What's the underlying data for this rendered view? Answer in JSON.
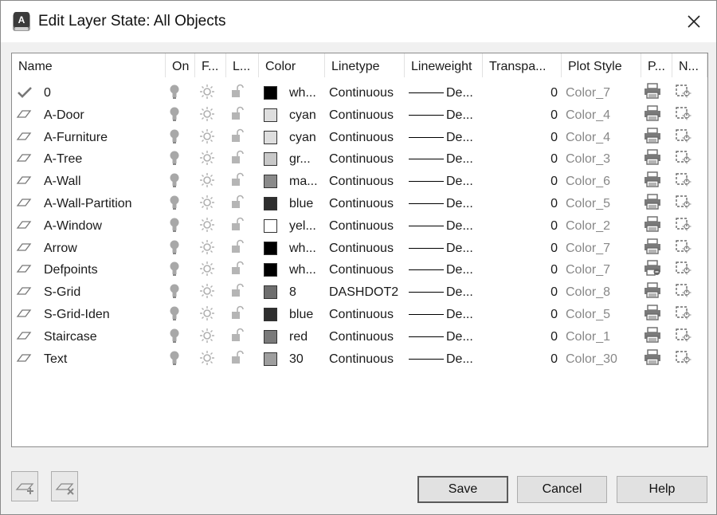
{
  "window": {
    "title": "Edit Layer State: All Objects"
  },
  "columns": [
    "Name",
    "On",
    "F...",
    "L...",
    "Color",
    "Linetype",
    "Lineweight",
    "Transpa...",
    "Plot Style",
    "P...",
    "N..."
  ],
  "layers": [
    {
      "current": true,
      "name": "0",
      "color_name": "wh...",
      "swatch": "#000000",
      "linetype": "Continuous",
      "lineweight": "De...",
      "transparency": "0",
      "plot_style": "Color_7",
      "plot_icon": "printer-icon"
    },
    {
      "current": false,
      "name": "A-Door",
      "color_name": "cyan",
      "swatch": "#dedede",
      "linetype": "Continuous",
      "lineweight": "De...",
      "transparency": "0",
      "plot_style": "Color_4",
      "plot_icon": "printer-icon"
    },
    {
      "current": false,
      "name": "A-Furniture",
      "color_name": "cyan",
      "swatch": "#dedede",
      "linetype": "Continuous",
      "lineweight": "De...",
      "transparency": "0",
      "plot_style": "Color_4",
      "plot_icon": "printer-icon"
    },
    {
      "current": false,
      "name": "A-Tree",
      "color_name": "gr...",
      "swatch": "#c8c8c8",
      "linetype": "Continuous",
      "lineweight": "De...",
      "transparency": "0",
      "plot_style": "Color_3",
      "plot_icon": "printer-icon"
    },
    {
      "current": false,
      "name": "A-Wall",
      "color_name": "ma...",
      "swatch": "#8a8a8a",
      "linetype": "Continuous",
      "lineweight": "De...",
      "transparency": "0",
      "plot_style": "Color_6",
      "plot_icon": "printer-icon"
    },
    {
      "current": false,
      "name": "A-Wall-Partition",
      "color_name": "blue",
      "swatch": "#2e2e2e",
      "linetype": "Continuous",
      "lineweight": "De...",
      "transparency": "0",
      "plot_style": "Color_5",
      "plot_icon": "printer-icon"
    },
    {
      "current": false,
      "name": "A-Window",
      "color_name": "yel...",
      "swatch": "#ffffff",
      "linetype": "Continuous",
      "lineweight": "De...",
      "transparency": "0",
      "plot_style": "Color_2",
      "plot_icon": "printer-icon"
    },
    {
      "current": false,
      "name": "Arrow",
      "color_name": "wh...",
      "swatch": "#000000",
      "linetype": "Continuous",
      "lineweight": "De...",
      "transparency": "0",
      "plot_style": "Color_7",
      "plot_icon": "printer-icon"
    },
    {
      "current": false,
      "name": "Defpoints",
      "color_name": "wh...",
      "swatch": "#000000",
      "linetype": "Continuous",
      "lineweight": "De...",
      "transparency": "0",
      "plot_style": "Color_7",
      "plot_icon": "no-plot-printer-icon"
    },
    {
      "current": false,
      "name": "S-Grid",
      "color_name": "8",
      "swatch": "#6e6e6e",
      "linetype": "DASHDOT2",
      "lineweight": "De...",
      "transparency": "0",
      "plot_style": "Color_8",
      "plot_icon": "printer-icon"
    },
    {
      "current": false,
      "name": "S-Grid-Iden",
      "color_name": "blue",
      "swatch": "#2e2e2e",
      "linetype": "Continuous",
      "lineweight": "De...",
      "transparency": "0",
      "plot_style": "Color_5",
      "plot_icon": "printer-icon"
    },
    {
      "current": false,
      "name": "Staircase",
      "color_name": "red",
      "swatch": "#7a7a7a",
      "linetype": "Continuous",
      "lineweight": "De...",
      "transparency": "0",
      "plot_style": "Color_1",
      "plot_icon": "printer-icon"
    },
    {
      "current": false,
      "name": "Text",
      "color_name": "30",
      "swatch": "#9e9e9e",
      "linetype": "Continuous",
      "lineweight": "De...",
      "transparency": "0",
      "plot_style": "Color_30",
      "plot_icon": "printer-icon"
    }
  ],
  "buttons": {
    "save": "Save",
    "cancel": "Cancel",
    "help": "Help"
  },
  "icons": {
    "app": "app-logo-icon",
    "close": "close-icon",
    "add_layers": "add-layers-icon",
    "remove_layers": "remove-layers-icon"
  }
}
